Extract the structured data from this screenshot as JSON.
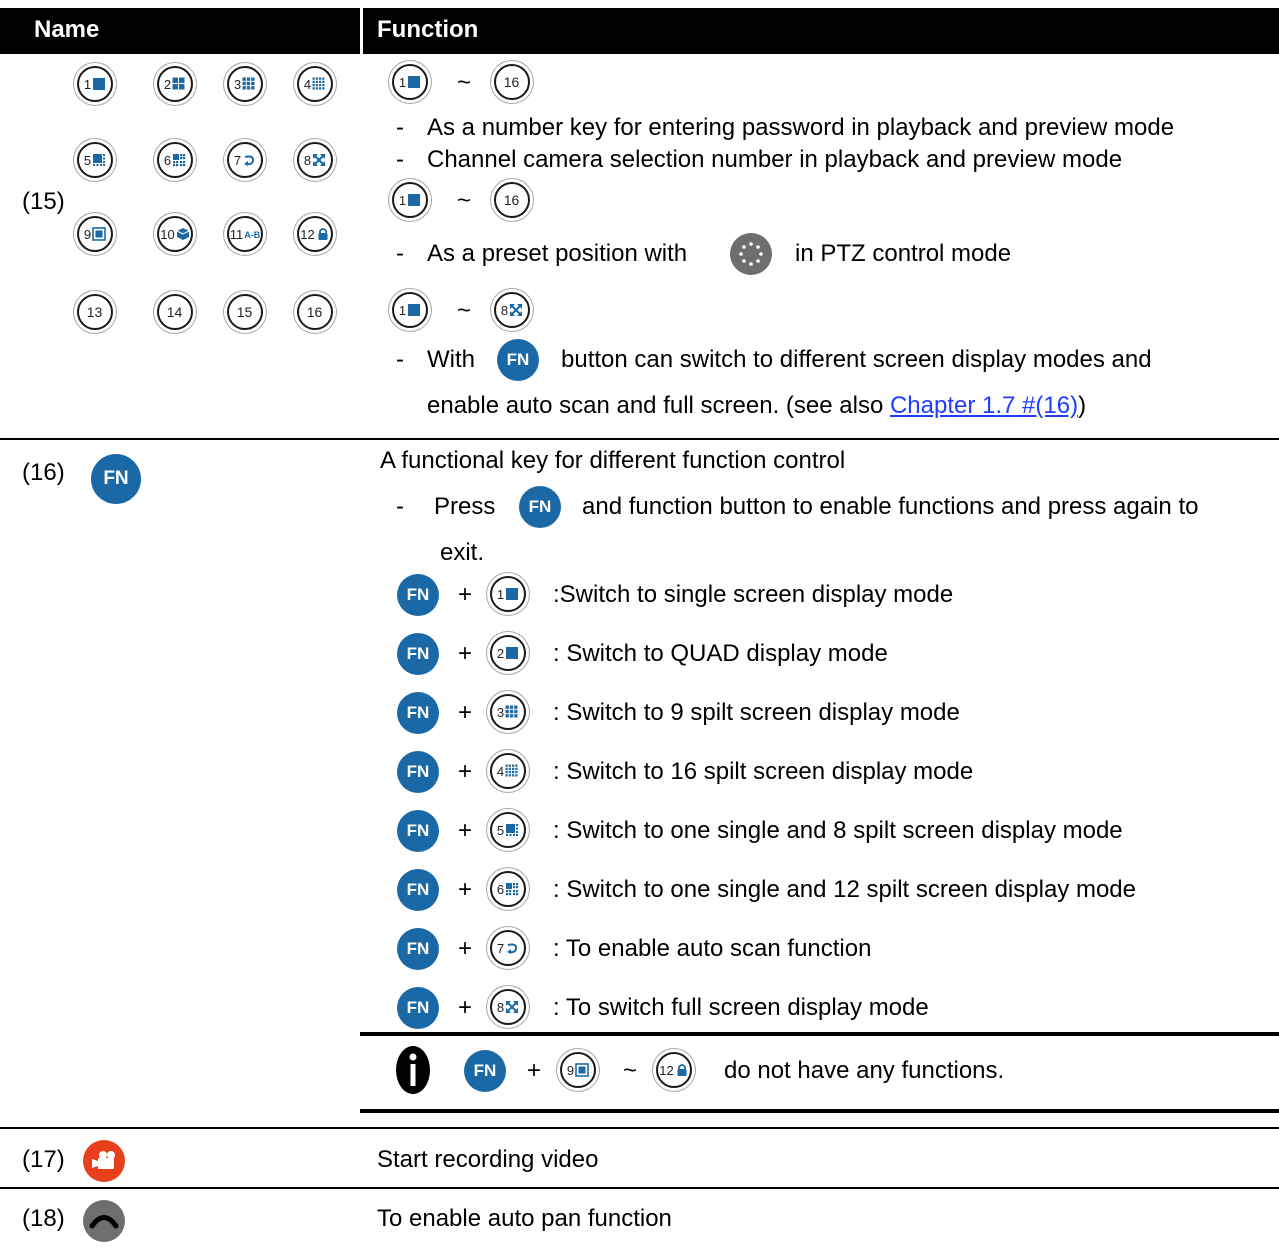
{
  "header": {
    "name": "Name",
    "function": "Function"
  },
  "rows": {
    "r15": {
      "label": "(15)",
      "keys": [
        {
          "num": "1",
          "glyph": "single"
        },
        {
          "num": "2",
          "glyph": "quad"
        },
        {
          "num": "3",
          "glyph": "nine"
        },
        {
          "num": "4",
          "glyph": "sixteen"
        },
        {
          "num": "5",
          "glyph": "onesplit8"
        },
        {
          "num": "6",
          "glyph": "onesplit12"
        },
        {
          "num": "7",
          "glyph": "autoscan"
        },
        {
          "num": "8",
          "glyph": "fullscreen"
        },
        {
          "num": "9",
          "glyph": "pip"
        },
        {
          "num": "10",
          "glyph": "cube"
        },
        {
          "num": "11",
          "glyph": "ab"
        },
        {
          "num": "12",
          "glyph": "lock"
        },
        {
          "num": "13",
          "glyph": ""
        },
        {
          "num": "14",
          "glyph": ""
        },
        {
          "num": "15",
          "glyph": ""
        },
        {
          "num": "16",
          "glyph": ""
        }
      ],
      "tilde": "~",
      "dash": "-",
      "line1": "As a number key for entering password in playback and preview mode",
      "line2": "Channel camera selection number in playback and preview mode",
      "line3a": "As a preset position with",
      "line3b": "in PTZ control mode",
      "line4a": "With",
      "line4b": "button can switch to different screen display modes and",
      "line5a": "enable auto scan and full screen. (see also ",
      "line5link": "Chapter 1.7 #(16)",
      "line5b": ")"
    },
    "r16": {
      "label": "(16)",
      "fn": "FN",
      "intro": "A functional key for different function control",
      "press_a": "Press",
      "press_b": "and function button to enable functions and press again to",
      "press_c": "exit.",
      "plus": "+",
      "combos": [
        {
          "num": "1",
          "glyph": "single",
          "text": ":Switch to single screen display mode"
        },
        {
          "num": "2",
          "glyph": "single",
          "text": ": Switch to QUAD display mode"
        },
        {
          "num": "3",
          "glyph": "nine",
          "text": ": Switch to 9 spilt screen display mode"
        },
        {
          "num": "4",
          "glyph": "sixteen",
          "text": ": Switch to 16 spilt screen display mode"
        },
        {
          "num": "5",
          "glyph": "onesplit8",
          "text": ": Switch to one single and 8 spilt screen display mode"
        },
        {
          "num": "6",
          "glyph": "onesplit12",
          "text": ": Switch to one single and 12 spilt screen display mode"
        },
        {
          "num": "7",
          "glyph": "autoscan",
          "text": ": To enable auto scan function"
        },
        {
          "num": "8",
          "glyph": "fullscreen",
          "text": ": To switch full screen display mode"
        }
      ],
      "note": "do not have any functions."
    },
    "r17": {
      "label": "(17)",
      "text": "Start recording video"
    },
    "r18": {
      "label": "(18)",
      "text": "To enable auto pan function"
    }
  },
  "colors": {
    "fn_blue": "#1a69a6",
    "key_blue": "#1a69a6",
    "record_red": "#e8401c",
    "pan_grey": "#6e6e6e",
    "link": "#1f3cff"
  }
}
